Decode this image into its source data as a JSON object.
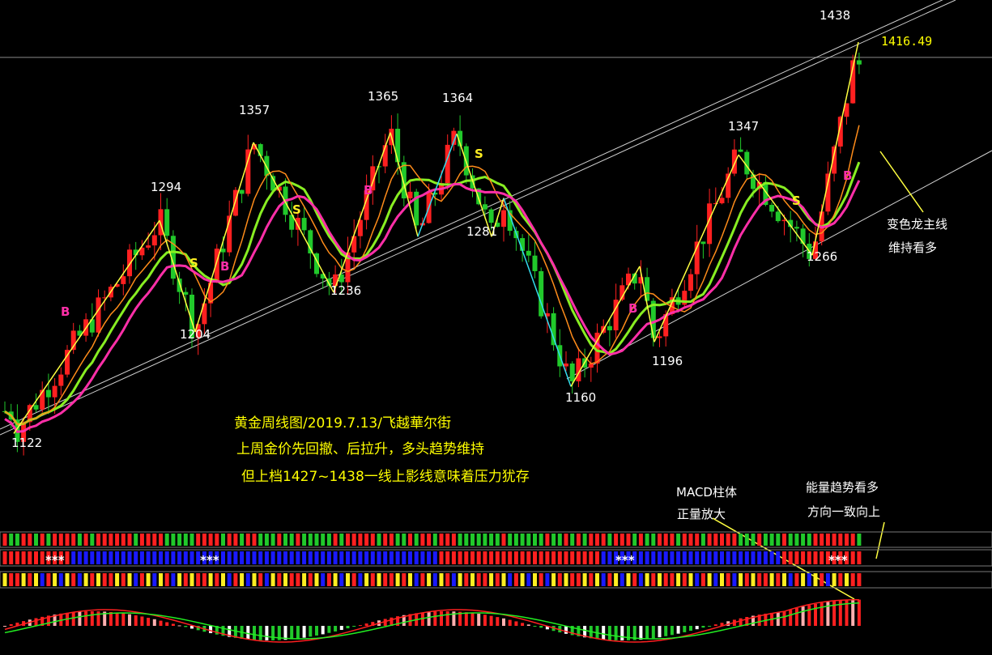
{
  "chart_data": {
    "type": "candlestick",
    "title": "黄金周线图/2019.7.13/飞越華尔街",
    "subtitle_lines": [
      "上周金价先回撤、后拉升，多头趋势维持",
      "但上档1427~1438一线上影线意味着压力犹存"
    ],
    "current_price": "1416.49",
    "swing_points": [
      {
        "label": "1122",
        "value": 1122
      },
      {
        "label": "1294",
        "value": 1294
      },
      {
        "label": "1204",
        "value": 1204
      },
      {
        "label": "1357",
        "value": 1357
      },
      {
        "label": "1236",
        "value": 1236
      },
      {
        "label": "1365",
        "value": 1365
      },
      {
        "label": "1364",
        "value": 1364
      },
      {
        "label": "1281",
        "value": 1281
      },
      {
        "label": "1160",
        "value": 1160
      },
      {
        "label": "1196",
        "value": 1196
      },
      {
        "label": "1347",
        "value": 1347
      },
      {
        "label": "1266",
        "value": 1266
      },
      {
        "label": "1438",
        "value": 1438
      }
    ],
    "signals": [
      "B",
      "S",
      "B",
      "S",
      "B",
      "S",
      "B",
      "S",
      "B"
    ],
    "annotations": {
      "dragon_line": [
        "变色龙主线",
        "维持看多"
      ],
      "macd": [
        "MACD柱体",
        "正量放大"
      ],
      "energy": [
        "能量趋势看多",
        "方向一致向上"
      ]
    },
    "marker_text": "***",
    "colors": {
      "up": "#ff2020",
      "down": "#21c92b",
      "zigzag": "#ffff40",
      "cyan": "#33ddee",
      "ma_green": "#88ee22",
      "ma_orange": "#ff8c1a",
      "ma_pink": "#ff2fa8",
      "macd_dif": "#ff2020",
      "macd_dea": "#22ee22",
      "strip_blue": "#1a1aff",
      "strip_yellow": "#ffee22"
    }
  }
}
